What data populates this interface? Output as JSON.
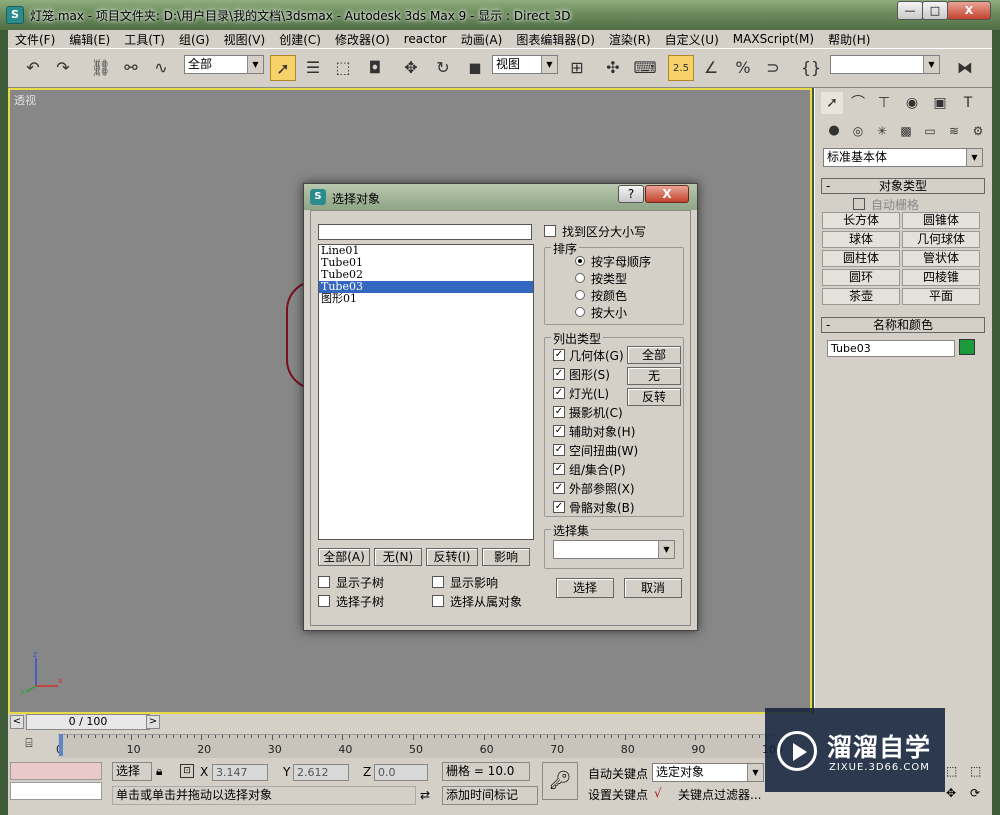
{
  "window": {
    "title": "灯笼.max    - 项目文件夹: D:\\用户目录\\我的文档\\3dsmax    - Autodesk 3ds Max 9    - 显示 : Direct 3D",
    "minimize": "—",
    "maximize": "□",
    "close": "X"
  },
  "menu": [
    "文件(F)",
    "编辑(E)",
    "工具(T)",
    "组(G)",
    "视图(V)",
    "创建(C)",
    "修改器(O)",
    "reactor",
    "动画(A)",
    "图表编辑器(D)",
    "渲染(R)",
    "自定义(U)",
    "MAXScript(M)",
    "帮助(H)"
  ],
  "toolbar": {
    "selection_filter": "全部",
    "reference_coord": "视图",
    "snap_value": "2.5",
    "named_selection": ""
  },
  "viewport": {
    "label": "透视"
  },
  "command_panel": {
    "category": "标准基本体",
    "object_type_title": "对象类型",
    "autogrid": "自动栅格",
    "primitives": [
      "长方体",
      "圆锥体",
      "球体",
      "几何球体",
      "圆柱体",
      "管状体",
      "圆环",
      "四棱锥",
      "茶壶",
      "平面"
    ],
    "name_color_title": "名称和颜色",
    "object_name": "Tube03",
    "object_color": "#1a9a3c"
  },
  "timeline": {
    "frame_display": "0 / 100",
    "ticks": [
      "0",
      "10",
      "20",
      "30",
      "40",
      "50",
      "60",
      "70",
      "80",
      "90",
      "100"
    ]
  },
  "status": {
    "select_label": "选择",
    "x_label": "X",
    "x_value": "3.147",
    "y_label": "Y",
    "y_value": "2.612",
    "z_label": "Z",
    "z_value": "0.0",
    "grid": "栅格 = 10.0",
    "auto_key": "自动关键点",
    "set_key": "设置关键点",
    "key_mode": "选定对象",
    "key_filter": "关键点过滤器...",
    "prompt": "单击或单击并拖动以选择对象",
    "add_time_tag": "添加时间标记"
  },
  "watermark": {
    "title": "溜溜自学",
    "subtitle": "ZIXUE.3D66.COM"
  },
  "dialog": {
    "title": "选择对象",
    "help": "?",
    "close": "X",
    "search_value": "",
    "objects": [
      "Line01",
      "Tube01",
      "Tube02",
      "Tube03",
      "图形01"
    ],
    "selected_index": 3,
    "list_buttons": [
      "全部(A)",
      "无(N)",
      "反转(I)",
      "影响"
    ],
    "case_sensitive": "找到区分大小写",
    "sort_title": "排序",
    "sort_options": [
      "按字母顺序",
      "按类型",
      "按颜色",
      "按大小"
    ],
    "sort_selected": 0,
    "list_types_title": "列出类型",
    "list_types": [
      "几何体(G)",
      "图形(S)",
      "灯光(L)",
      "摄影机(C)",
      "辅助对象(H)",
      "空间扭曲(W)",
      "组/集合(P)",
      "外部参照(X)",
      "骨骼对象(B)"
    ],
    "type_buttons": [
      "全部",
      "无",
      "反转"
    ],
    "selection_set_title": "选择集",
    "selection_set_value": "",
    "show_subtree": "显示子树",
    "select_subtree": "选择子树",
    "show_influences": "显示影响",
    "select_dependents": "选择从属对象",
    "ok": "选择",
    "cancel": "取消"
  }
}
